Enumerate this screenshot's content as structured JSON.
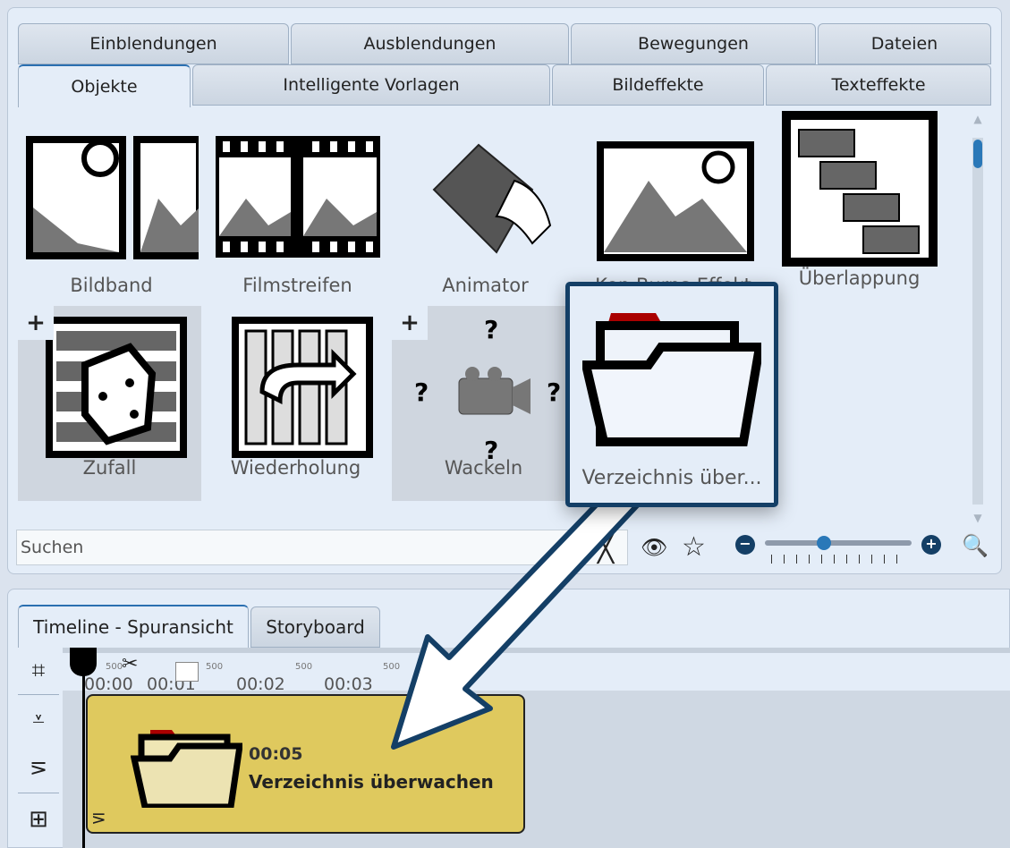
{
  "effects_panel": {
    "tabs_row1": [
      {
        "label": "Einblendungen"
      },
      {
        "label": "Ausblendungen"
      },
      {
        "label": "Bewegungen"
      },
      {
        "label": "Dateien"
      }
    ],
    "tabs_row2": [
      {
        "label": "Objekte",
        "active": true
      },
      {
        "label": "Intelligente Vorlagen"
      },
      {
        "label": "Bildeffekte"
      },
      {
        "label": "Texteffekte"
      }
    ],
    "items": [
      {
        "label": "Bildband"
      },
      {
        "label": "Filmstreifen"
      },
      {
        "label": "Animator"
      },
      {
        "label": "Ken-Burns-Effekt"
      },
      {
        "label": "Überlappung"
      },
      {
        "label": "Zufall",
        "badge": "+"
      },
      {
        "label": "Wiederholung"
      },
      {
        "label": "Wackeln",
        "badge": "+"
      }
    ],
    "drag_item": {
      "label": "Verzeichnis über..."
    },
    "search": {
      "placeholder": "Suchen"
    },
    "zoom_slider": {
      "value_fraction": 0.4
    },
    "colors": {
      "accent": "#143f66",
      "slider": "#2a78b8"
    }
  },
  "timeline": {
    "tabs": [
      {
        "label": "Timeline - Spuransicht",
        "active": true
      },
      {
        "label": "Storyboard"
      }
    ],
    "ruler": {
      "time_labels": [
        "00:00",
        "00:01",
        "00:02",
        "00:03"
      ],
      "sub_labels": [
        "500",
        "500",
        "500",
        "500"
      ]
    },
    "clip": {
      "duration": "00:05",
      "title": "Verzeichnis überwachen",
      "color": "#dfc95e"
    }
  }
}
